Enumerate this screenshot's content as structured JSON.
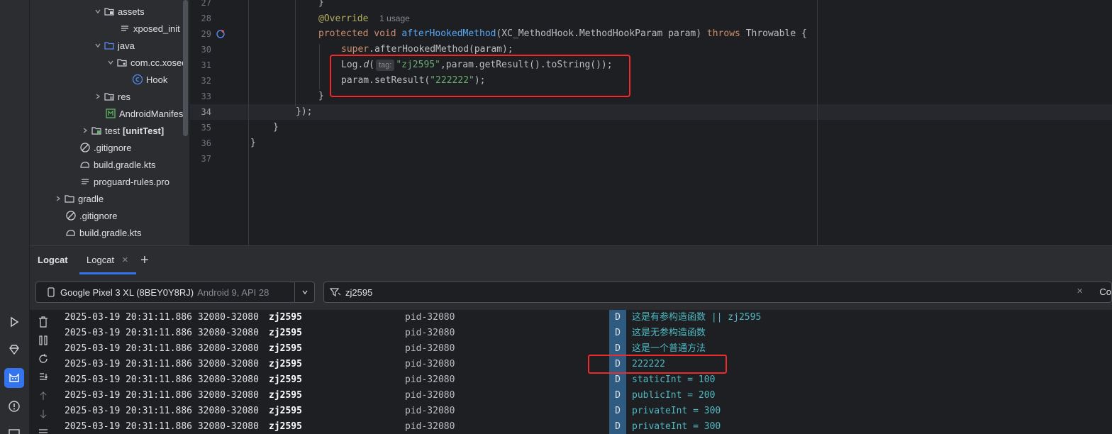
{
  "project_tree": {
    "items": [
      {
        "label": "assets",
        "icon": "folder-icon",
        "chevron": "down"
      },
      {
        "label": "xposed_init",
        "icon": "text-file-icon",
        "chevron": ""
      },
      {
        "label": "java",
        "icon": "source-folder-icon",
        "chevron": "down"
      },
      {
        "label": "com.cc.xosed",
        "icon": "package-icon",
        "chevron": "down"
      },
      {
        "label": "Hook",
        "icon": "class-icon",
        "chevron": ""
      },
      {
        "label": "res",
        "icon": "resource-folder-icon",
        "chevron": "right"
      },
      {
        "label": "AndroidManifest",
        "icon": "manifest-icon",
        "chevron": ""
      },
      {
        "label": "test",
        "extra": "[unitTest]",
        "icon": "test-folder-icon",
        "chevron": "right"
      },
      {
        "label": ".gitignore",
        "icon": "ignore-file-icon",
        "chevron": ""
      },
      {
        "label": "build.gradle.kts",
        "icon": "gradle-icon",
        "chevron": ""
      },
      {
        "label": "proguard-rules.pro",
        "icon": "text-file-icon",
        "chevron": ""
      },
      {
        "label": "gradle",
        "icon": "folder-icon",
        "chevron": "right"
      },
      {
        "label": ".gitignore",
        "icon": "ignore-file-icon",
        "chevron": ""
      },
      {
        "label": "build.gradle.kts",
        "icon": "gradle-icon",
        "chevron": ""
      }
    ]
  },
  "editor": {
    "line_numbers": [
      "27",
      "28",
      "29",
      "30",
      "31",
      "32",
      "33",
      "34",
      "35",
      "36",
      "37"
    ],
    "current_line": "34",
    "usage_hint": "1 usage",
    "tag_hint": "tag:",
    "lines": {
      "l27": "}",
      "l28_annot": "@Override",
      "l29_kw1": "protected",
      "l29_kw2": "void",
      "l29_fn": "afterHookedMethod",
      "l29_params": "(XC_MethodHook.MethodHookParam param)",
      "l29_kw3": "throws",
      "l29_tail": "Throwable {",
      "l30_kw": "super",
      "l30_rest": ".afterHookedMethod(param);",
      "l31_a": "Log.",
      "l31_fn": "d",
      "l31_b": "(",
      "l31_str": "\"zj2595\"",
      "l31_c": ",param.getResult().toString());",
      "l32_a": "param.setResult(",
      "l32_str": "\"222222\"",
      "l32_b": ");",
      "l33": "}",
      "l34": "});",
      "l35": "}",
      "l36": "}"
    }
  },
  "logcat": {
    "tabs": [
      "Logcat",
      "Logcat"
    ],
    "add_tab": "+",
    "close_glyph": "×",
    "device": "Google Pixel 3 XL (8BEY0Y8RJ)",
    "device_detail": "Android 9, API 28",
    "filter_value": "zj2595",
    "clear_glyph": "×",
    "trailing_text": "Co",
    "rows": [
      {
        "ts": "2025-03-19 20:31:11.886 32080-32080",
        "tag": "zj2595",
        "pkg": "pid-32080",
        "level": "D",
        "msg": "这是有参构造函数 || zj2595"
      },
      {
        "ts": "2025-03-19 20:31:11.886 32080-32080",
        "tag": "zj2595",
        "pkg": "pid-32080",
        "level": "D",
        "msg": "这是无参构造函数"
      },
      {
        "ts": "2025-03-19 20:31:11.886 32080-32080",
        "tag": "zj2595",
        "pkg": "pid-32080",
        "level": "D",
        "msg": "这是一个普通方法"
      },
      {
        "ts": "2025-03-19 20:31:11.886 32080-32080",
        "tag": "zj2595",
        "pkg": "pid-32080",
        "level": "D",
        "msg": "222222"
      },
      {
        "ts": "2025-03-19 20:31:11.886 32080-32080",
        "tag": "zj2595",
        "pkg": "pid-32080",
        "level": "D",
        "msg": "staticInt = 100"
      },
      {
        "ts": "2025-03-19 20:31:11.886 32080-32080",
        "tag": "zj2595",
        "pkg": "pid-32080",
        "level": "D",
        "msg": "publicInt = 200"
      },
      {
        "ts": "2025-03-19 20:31:11.886 32080-32080",
        "tag": "zj2595",
        "pkg": "pid-32080",
        "level": "D",
        "msg": "privateInt = 300"
      },
      {
        "ts": "2025-03-19 20:31:11.886 32080-32080",
        "tag": "zj2595",
        "pkg": "pid-32080",
        "level": "D",
        "msg": "privateInt = 300"
      }
    ]
  },
  "colors": {
    "highlight_border": "#ee2a2a",
    "accent": "#3574f0",
    "log_message": "#4fb8c2",
    "level_badge": "#2e5b82"
  }
}
